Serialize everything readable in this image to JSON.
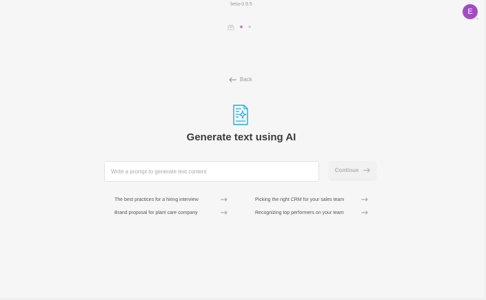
{
  "header": {
    "version": "beta-0.9.5",
    "avatar_initial": "E",
    "steps": {
      "count": 2,
      "active_step": 1
    }
  },
  "back": {
    "label": "Back"
  },
  "hero": {
    "title": "Generate text using AI",
    "icon": "document-sparkle-icon"
  },
  "prompt": {
    "placeholder": "Write a prompt to generate text content",
    "value": ""
  },
  "continue": {
    "label": "Continue",
    "enabled": false
  },
  "suggestions": [
    {
      "label": "The best practices for a hiring interview"
    },
    {
      "label": "Picking the right CRM for your sales team"
    },
    {
      "label": "Brand proposal for plant care company"
    },
    {
      "label": "Recognizing top performers on your team"
    }
  ],
  "colors": {
    "accent": "#a24cc2",
    "icon": "#20a8d8",
    "background": "#f6f6f6"
  }
}
